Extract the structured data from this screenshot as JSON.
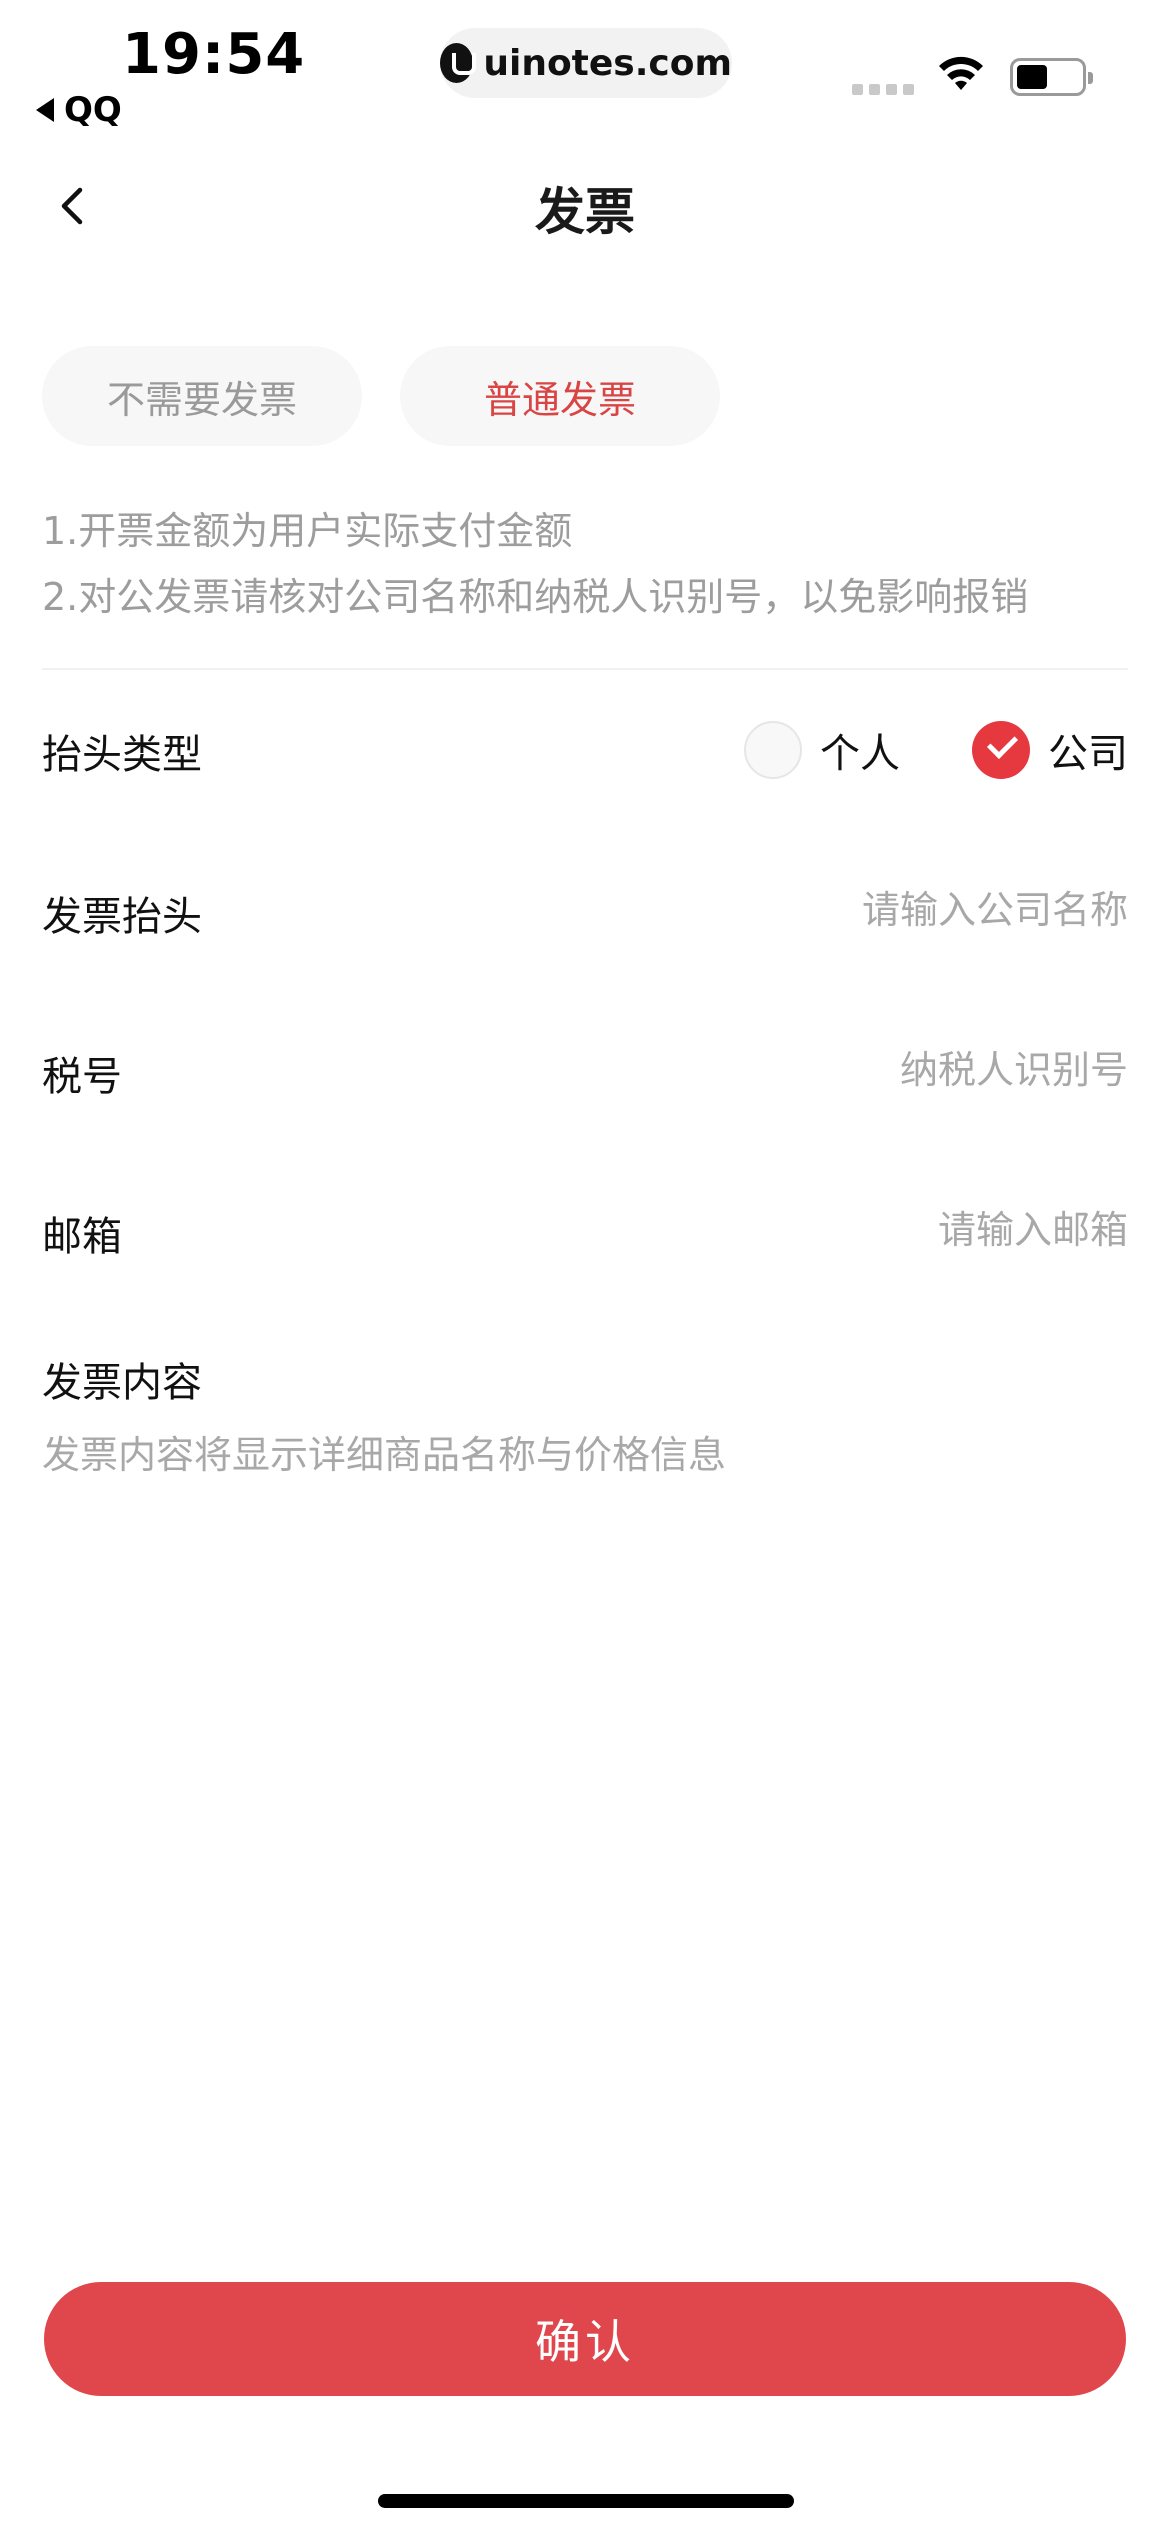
{
  "status_bar": {
    "time": "19:54",
    "back_app": "QQ",
    "url": "uinotes.com"
  },
  "nav": {
    "title": "发票"
  },
  "invoice_tabs": [
    {
      "label": "不需要发票",
      "selected": false
    },
    {
      "label": "普通发票",
      "selected": true
    }
  ],
  "notes": [
    "1.开票金额为用户实际支付金额",
    "2.对公发票请核对公司名称和纳税人识别号，以免影响报销"
  ],
  "header_type": {
    "label": "抬头类型",
    "options": [
      {
        "label": "个人",
        "checked": false
      },
      {
        "label": "公司",
        "checked": true
      }
    ]
  },
  "form": {
    "invoice_title": {
      "label": "发票抬头",
      "placeholder": "请输入公司名称",
      "value": ""
    },
    "tax_number": {
      "label": "税号",
      "placeholder": "纳税人识别号",
      "value": ""
    },
    "email": {
      "label": "邮箱",
      "placeholder": "请输入邮箱",
      "value": ""
    }
  },
  "invoice_content": {
    "label": "发票内容",
    "description": "发票内容将显示详细商品名称与价格信息"
  },
  "confirm_button": "确认",
  "colors": {
    "accent": "#e0474d",
    "accent_text": "#d94545",
    "placeholder": "#a8a8a8"
  }
}
